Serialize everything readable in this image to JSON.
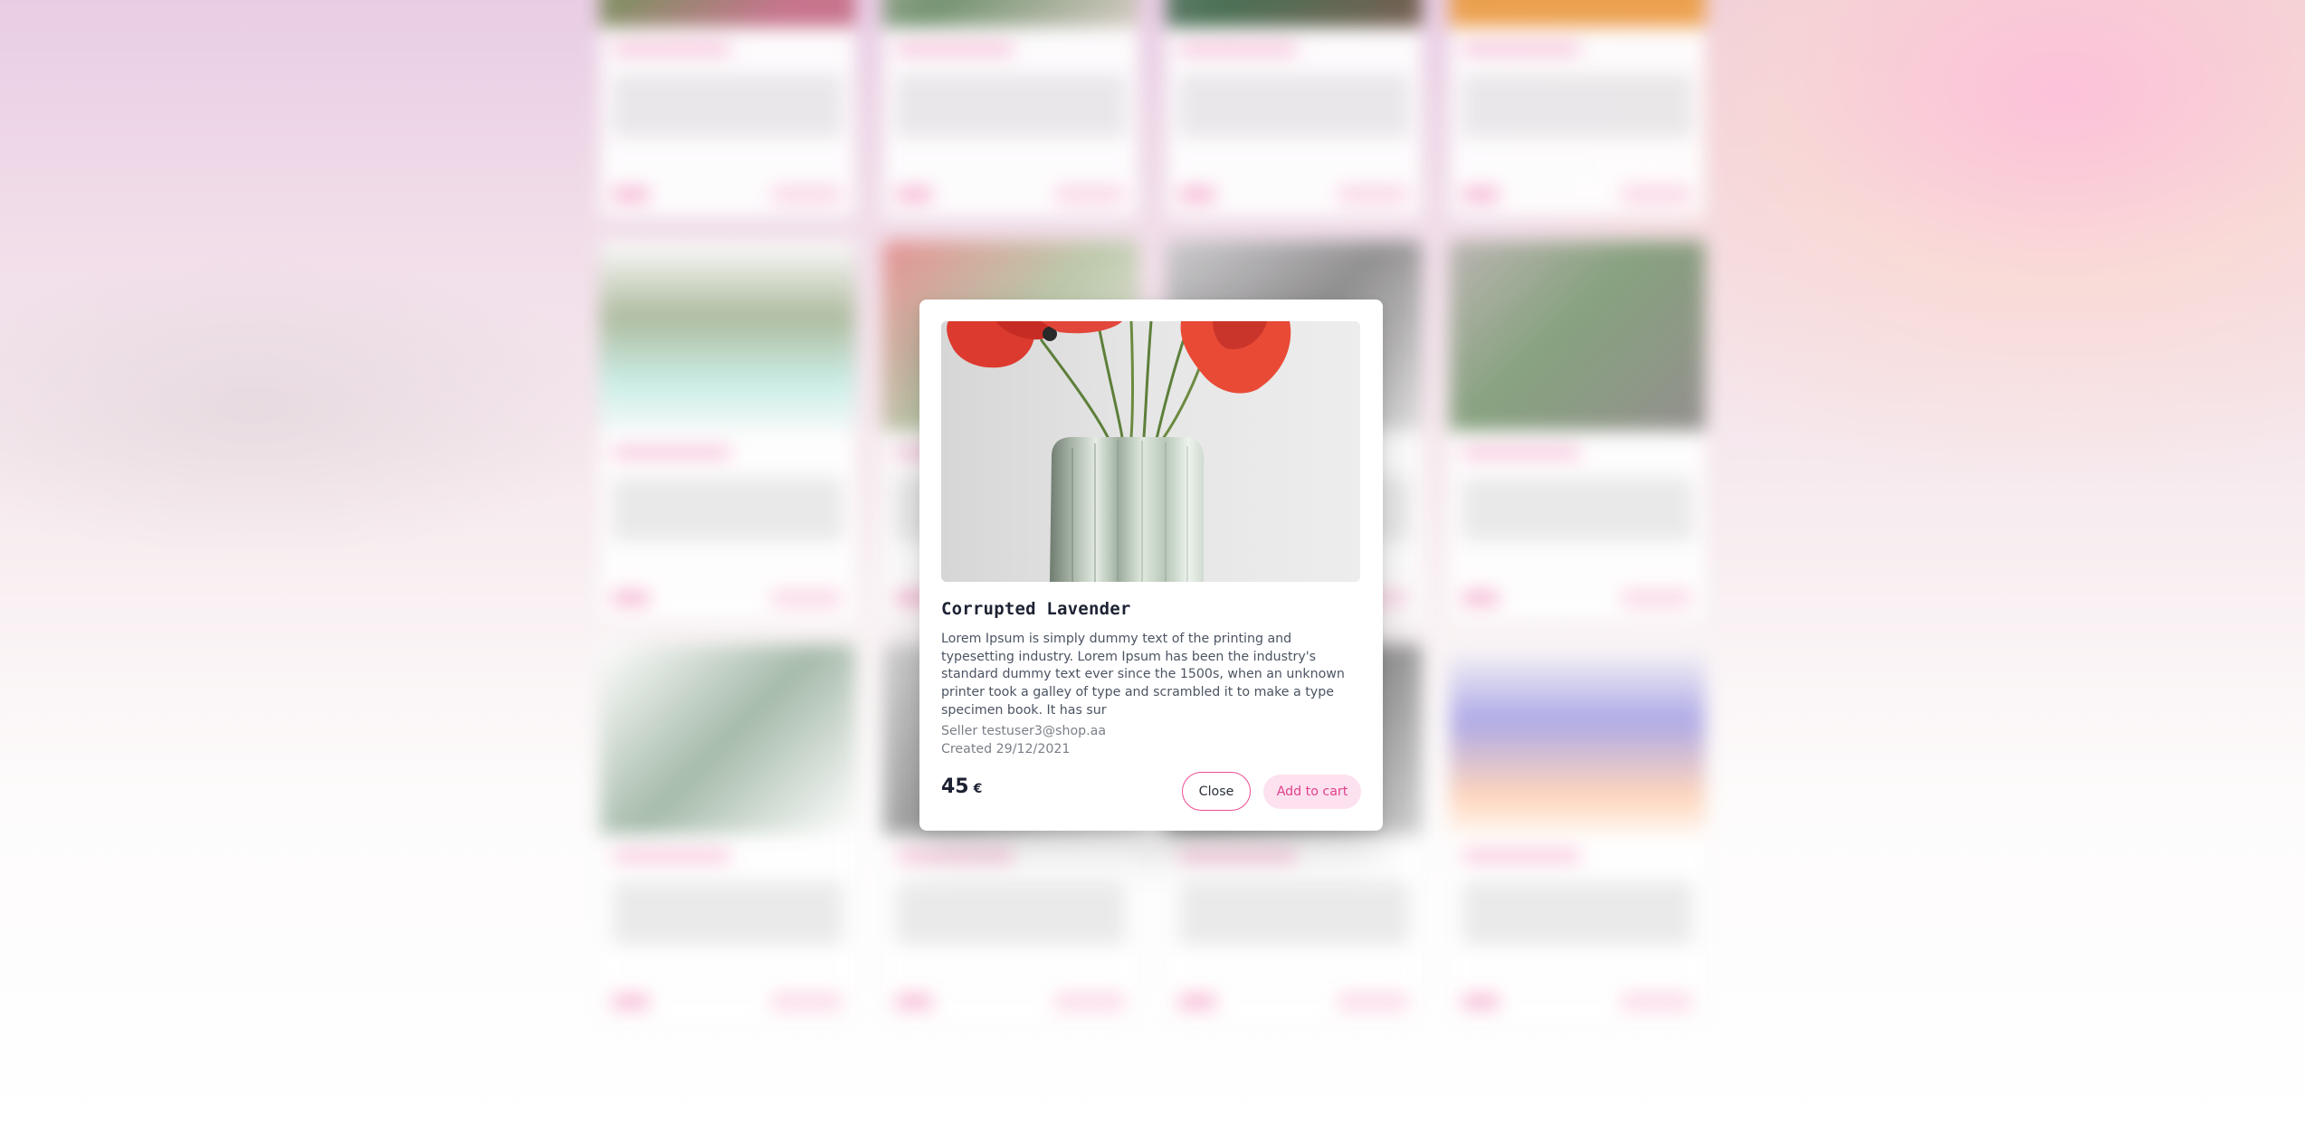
{
  "product": {
    "title": "Corrupted Lavender",
    "description": "Lorem Ipsum is simply dummy text of the printing and typesetting industry. Lorem Ipsum has been the industry's standard dummy text ever since the 1500s, when an unknown printer took a galley of type and scrambled it to make a type specimen book. It has sur",
    "seller": "Seller testuser3@shop.aa",
    "created": "Created 29/12/2021",
    "price": "45",
    "currency": "€"
  },
  "actions": {
    "close_label": "Close",
    "add_to_cart_label": "Add to cart"
  },
  "colors": {
    "accent": "#ec4c93",
    "accent_soft": "#fde1ef",
    "text_dark": "#1d2233",
    "text_muted": "#7b7f88"
  }
}
